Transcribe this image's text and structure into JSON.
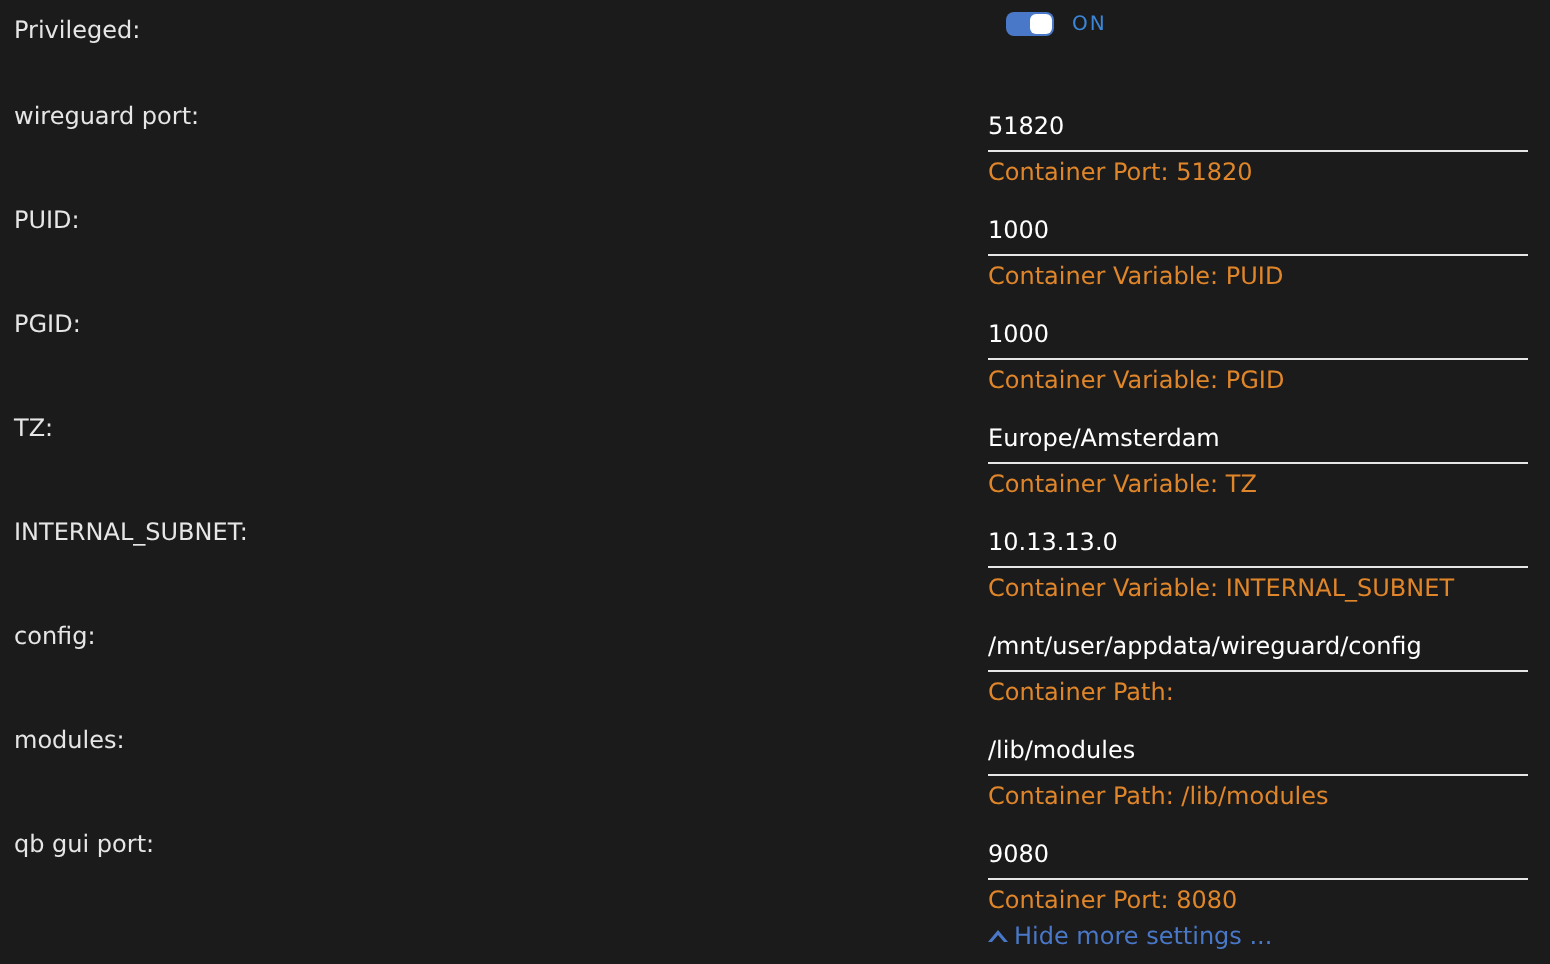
{
  "privileged": {
    "label": "Privileged:",
    "on": true,
    "state_text": "ON"
  },
  "fields": [
    {
      "label": "wireguard port:",
      "value": "51820",
      "hint": "Container Port: 51820"
    },
    {
      "label": "PUID:",
      "value": "1000",
      "hint": "Container Variable: PUID"
    },
    {
      "label": "PGID:",
      "value": "1000",
      "hint": "Container Variable: PGID"
    },
    {
      "label": "TZ:",
      "value": "Europe/Amsterdam",
      "hint": "Container Variable: TZ"
    },
    {
      "label": "INTERNAL_SUBNET:",
      "value": "10.13.13.0",
      "hint": "Container Variable: INTERNAL_SUBNET"
    },
    {
      "label": "config:",
      "value": "/mnt/user/appdata/wireguard/config",
      "hint": "Container Path:"
    },
    {
      "label": "modules:",
      "value": "/lib/modules",
      "hint": "Container Path: /lib/modules"
    },
    {
      "label": "qb gui port:",
      "value": "9080",
      "hint": "Container Port: 8080"
    }
  ],
  "hide_link": "Hide more settings ..."
}
